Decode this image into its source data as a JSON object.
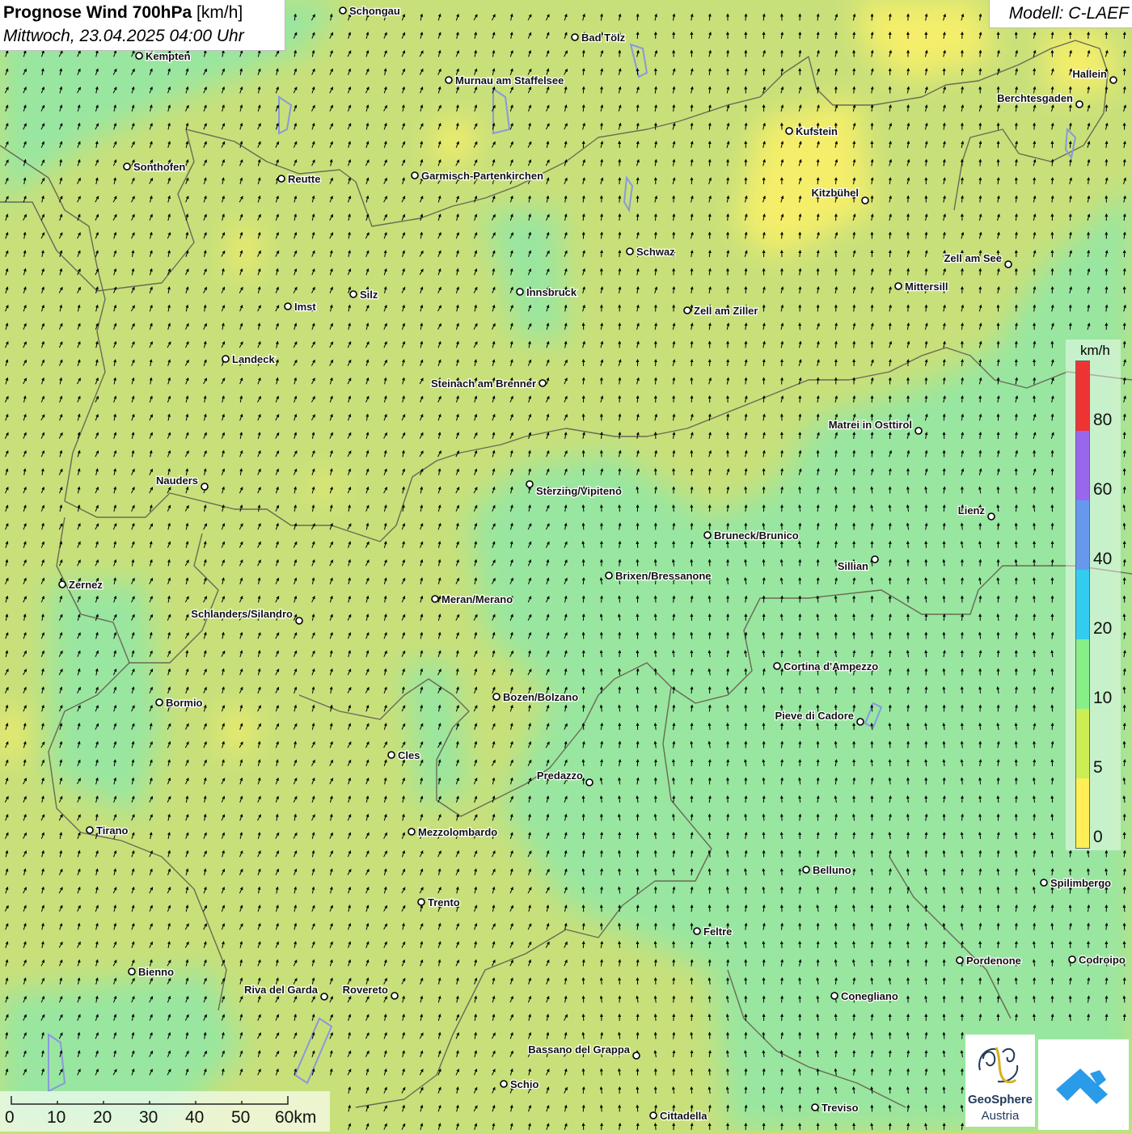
{
  "title": {
    "main": "Prognose Wind 700hPa",
    "unit": "[km/h]",
    "datetime": "Mittwoch, 23.04.2025 04:00 Uhr"
  },
  "model_label": "Modell: C-LAEF",
  "legend": {
    "unit": "km/h",
    "ticks": [
      "80",
      "60",
      "40",
      "20",
      "10",
      "5",
      "0"
    ],
    "colors": [
      "#ee3333",
      "#9966ee",
      "#6699ee",
      "#33ccee",
      "#88ee88",
      "#ccee55",
      "#ffee55"
    ]
  },
  "scale": {
    "labels": [
      "0",
      "10",
      "20",
      "30",
      "40",
      "50",
      "60km"
    ]
  },
  "logos": {
    "geosphere_line1": "GeoSphere",
    "geosphere_line2": "Austria"
  },
  "colors": {
    "field_green": "#c8e07a",
    "field_cyan": "#99e6a0",
    "field_yellow": "#f4ee6a",
    "border": "#6a6a55"
  },
  "cities": [
    {
      "name": "Schongau"
    },
    {
      "name": "Bad Tölz"
    },
    {
      "name": "Kempten"
    },
    {
      "name": "Murnau am Staffelsee"
    },
    {
      "name": "Hallein"
    },
    {
      "name": "Berchtesgaden"
    },
    {
      "name": "Kufstein"
    },
    {
      "name": "Sonthofen"
    },
    {
      "name": "Reutte"
    },
    {
      "name": "Garmisch-Partenkirchen"
    },
    {
      "name": "Kitzbühel"
    },
    {
      "name": "Schwaz"
    },
    {
      "name": "Zell am See"
    },
    {
      "name": "Mittersill"
    },
    {
      "name": "Innsbruck"
    },
    {
      "name": "Imst"
    },
    {
      "name": "Silz"
    },
    {
      "name": "Zell am Ziller"
    },
    {
      "name": "Landeck"
    },
    {
      "name": "Steinach am Brenner"
    },
    {
      "name": "Matrei in Osttirol"
    },
    {
      "name": "Nauders"
    },
    {
      "name": "Sterzing/Vipiteno"
    },
    {
      "name": "Lienz"
    },
    {
      "name": "Bruneck/Brunico"
    },
    {
      "name": "Sillian"
    },
    {
      "name": "Brixen/Bressanone"
    },
    {
      "name": "Zernez"
    },
    {
      "name": "Meran/Merano"
    },
    {
      "name": "Schlanders/Silandro"
    },
    {
      "name": "Cortina d'Ampezzo"
    },
    {
      "name": "Bozen/Bolzano"
    },
    {
      "name": "Bormio"
    },
    {
      "name": "Pieve di Cadore"
    },
    {
      "name": "Cles"
    },
    {
      "name": "Predazzo"
    },
    {
      "name": "Tirano"
    },
    {
      "name": "Mezzolombardo"
    },
    {
      "name": "Belluno"
    },
    {
      "name": "Spilimbergo"
    },
    {
      "name": "Trento"
    },
    {
      "name": "Feltre"
    },
    {
      "name": "Pordenone"
    },
    {
      "name": "Codroipo"
    },
    {
      "name": "Bienno"
    },
    {
      "name": "Riva del Garda"
    },
    {
      "name": "Rovereto"
    },
    {
      "name": "Conegliano"
    },
    {
      "name": "Bassano del Grappa"
    },
    {
      "name": "Schio"
    },
    {
      "name": "Treviso"
    },
    {
      "name": "Cittadella"
    }
  ]
}
